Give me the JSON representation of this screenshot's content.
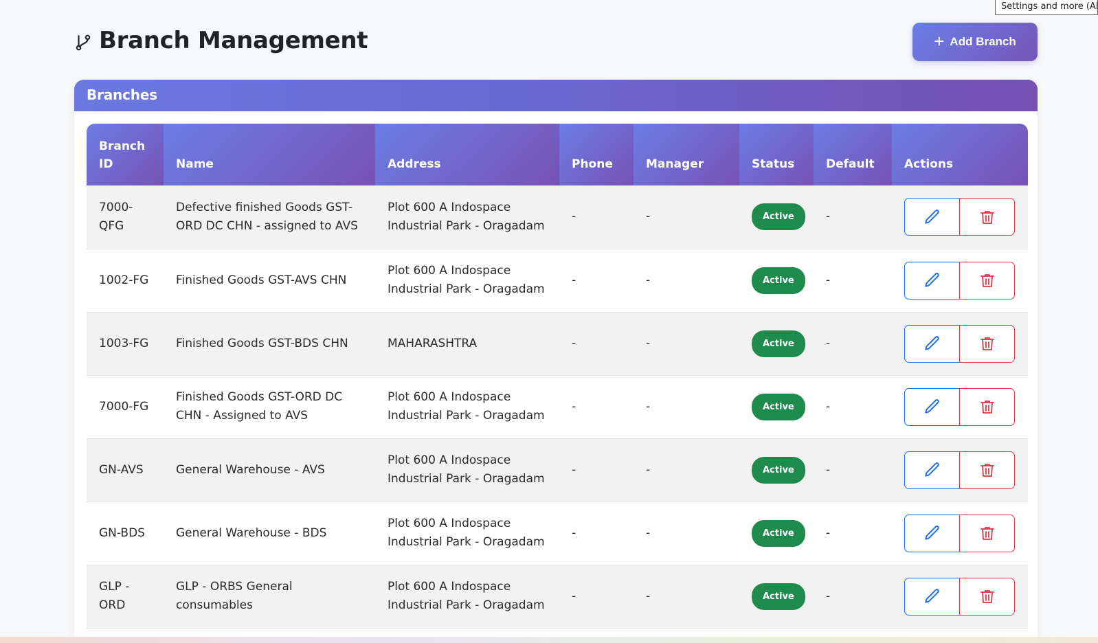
{
  "tooltip": "Settings and more (Alt+F)",
  "page": {
    "title": "Branch Management",
    "add_button_label": "Add Branch"
  },
  "card": {
    "title": "Branches"
  },
  "table": {
    "headers": [
      "Branch ID",
      "Name",
      "Address",
      "Phone",
      "Manager",
      "Status",
      "Default",
      "Actions"
    ],
    "rows": [
      {
        "id": "7000-QFG",
        "name": "Defective finished Goods GST-ORD DC CHN - assigned to AVS",
        "address": "Plot 600 A Indospace Industrial Park - Oragadam",
        "phone": "-",
        "manager": "-",
        "status": "Active",
        "default": "-"
      },
      {
        "id": "1002-FG",
        "name": "Finished Goods GST-AVS CHN",
        "address": "Plot 600 A Indospace Industrial Park - Oragadam",
        "phone": "-",
        "manager": "-",
        "status": "Active",
        "default": "-"
      },
      {
        "id": "1003-FG",
        "name": "Finished Goods GST-BDS CHN",
        "address": "MAHARASHTRA",
        "phone": "-",
        "manager": "-",
        "status": "Active",
        "default": "-"
      },
      {
        "id": "7000-FG",
        "name": "Finished Goods GST-ORD DC CHN - Assigned to AVS",
        "address": "Plot 600 A Indospace Industrial Park - Oragadam",
        "phone": "-",
        "manager": "-",
        "status": "Active",
        "default": "-"
      },
      {
        "id": "GN-AVS",
        "name": "General Warehouse - AVS",
        "address": "Plot 600 A Indospace Industrial Park - Oragadam",
        "phone": "-",
        "manager": "-",
        "status": "Active",
        "default": "-"
      },
      {
        "id": "GN-BDS",
        "name": "General Warehouse - BDS",
        "address": "Plot 600 A Indospace Industrial Park - Oragadam",
        "phone": "-",
        "manager": "-",
        "status": "Active",
        "default": "-"
      },
      {
        "id": "GLP - ORD",
        "name": "GLP - ORBS General consumables",
        "address": "Plot 600 A Indospace Industrial Park - Oragadam",
        "phone": "-",
        "manager": "-",
        "status": "Active",
        "default": "-"
      }
    ]
  },
  "icons": {
    "title": "git-branch-icon",
    "add": "plus-icon",
    "edit": "pencil-icon",
    "delete": "trash-icon"
  },
  "colors": {
    "accent_start": "#6a7ee6",
    "accent_end": "#7656b8",
    "active_badge": "#1e8a4c",
    "edit": "#1a6fe8",
    "delete": "#dc3545"
  }
}
